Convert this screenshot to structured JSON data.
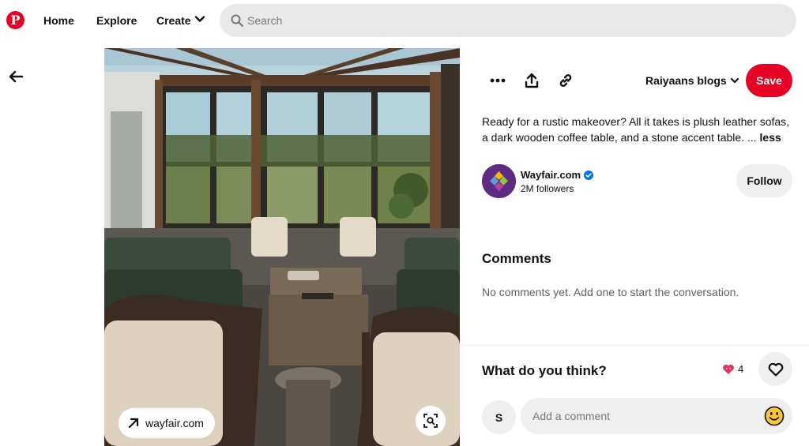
{
  "nav": {
    "logo": "P",
    "home": "Home",
    "explore": "Explore",
    "create": "Create",
    "search_placeholder": "Search"
  },
  "pin": {
    "source_label": "wayfair.com",
    "board": "Raiyaans blogs",
    "save": "Save",
    "description": "Ready for a rustic makeover? All it takes is plush leather sofas, a dark wooden coffee table, and a stone accent table.",
    "ellipsis": " ... ",
    "less": "less",
    "brand": {
      "name": "Wayfair.com",
      "followers": "2M followers",
      "follow": "Follow"
    },
    "comments": {
      "title": "Comments",
      "empty": "No comments yet. Add one to start the conversation."
    },
    "feedback": {
      "title": "What do you think?",
      "reaction_count": "4",
      "user_initial": "S",
      "comment_placeholder": "Add a comment"
    }
  },
  "colors": {
    "brand_red": "#e60023",
    "wayfair_purple": "#5e2a84",
    "verified_blue": "#0074e8"
  },
  "icons": [
    "pinterest-logo-icon",
    "chevron-down-icon",
    "search-icon",
    "back-arrow-icon",
    "more-icon",
    "share-icon",
    "link-icon",
    "verified-badge-icon",
    "heart-reaction-icon",
    "heart-outline-icon",
    "smiley-icon",
    "visual-search-icon",
    "arrow-up-right-icon"
  ]
}
